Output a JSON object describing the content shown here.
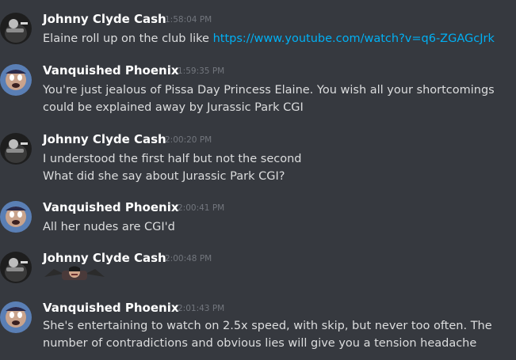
{
  "messages": [
    {
      "author": "Johnny Clyde Cash",
      "timestamp": "1:58:04 PM",
      "avatar_icon": "johnny-avatar-icon",
      "lines": [
        "Elaine roll up on the club like "
      ],
      "link": "https://www.youtube.com/watch?v=q6-ZGAGcJrk"
    },
    {
      "author": "Vanquished Phoenix",
      "timestamp": "1:59:35 PM",
      "avatar_icon": "phoenix-avatar-icon",
      "lines": [
        "You're just jealous of Pissa Day Princess Elaine. You wish all your shortcomings",
        "could be explained away by Jurassic Park CGI"
      ]
    },
    {
      "author": "Johnny Clyde Cash",
      "timestamp": "2:00:20 PM",
      "avatar_icon": "johnny-avatar-icon",
      "lines": [
        "I understood the first half but not the second",
        "What did she say about Jurassic Park CGI?"
      ]
    },
    {
      "author": "Vanquished Phoenix",
      "timestamp": "2:00:41 PM",
      "avatar_icon": "phoenix-avatar-icon",
      "lines": [
        "All her nudes are CGI'd"
      ]
    },
    {
      "author": "Johnny Clyde Cash",
      "timestamp": "2:00:48 PM",
      "avatar_icon": "johnny-avatar-icon",
      "lines": [],
      "sticker_icon": "reaction-sticker-icon"
    },
    {
      "author": "Vanquished Phoenix",
      "timestamp": "2:01:43 PM",
      "avatar_icon": "phoenix-avatar-icon",
      "lines": [
        "She's entertaining to watch on 2.5x speed, with skip, but never too often. The",
        "number of contradictions and obvious lies will give you a tension headache"
      ]
    }
  ],
  "colors": {
    "background": "#36393f",
    "username": "#ffffff",
    "timestamp": "#72767d",
    "message_text": "#dcddde",
    "link": "#00b0f4"
  }
}
